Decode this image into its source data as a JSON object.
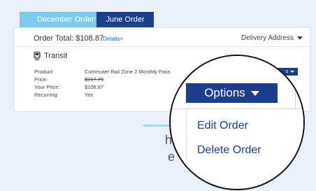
{
  "tabs": [
    "December Order",
    "June Order"
  ],
  "order": {
    "total_label": "Order Total: $108.87",
    "details_link": "Details>",
    "delivery_label": "Delivery Address",
    "section_title": "Transit",
    "fields": [
      {
        "label": "Product:",
        "value": "Commuter Rail Zone 2 Monthly Pass"
      },
      {
        "label": "Price:",
        "value": "$217.75"
      },
      {
        "label": "Your Price:",
        "value": "$108.87"
      },
      {
        "label": "Recurring:",
        "value": "Yes"
      }
    ],
    "mini_options_label": "s"
  },
  "background_fragments": [
    "ha",
    "e"
  ],
  "magnified": {
    "options_label": "Options",
    "menu_items": [
      "Edit Order",
      "Delete Order"
    ]
  },
  "colors": {
    "background": "#e9f0fb",
    "tab_inactive": "#7ccbee",
    "tab_active": "#1b3f8c",
    "link": "#1b3f8c"
  },
  "icons": [
    "train-icon",
    "caret-down-icon"
  ]
}
